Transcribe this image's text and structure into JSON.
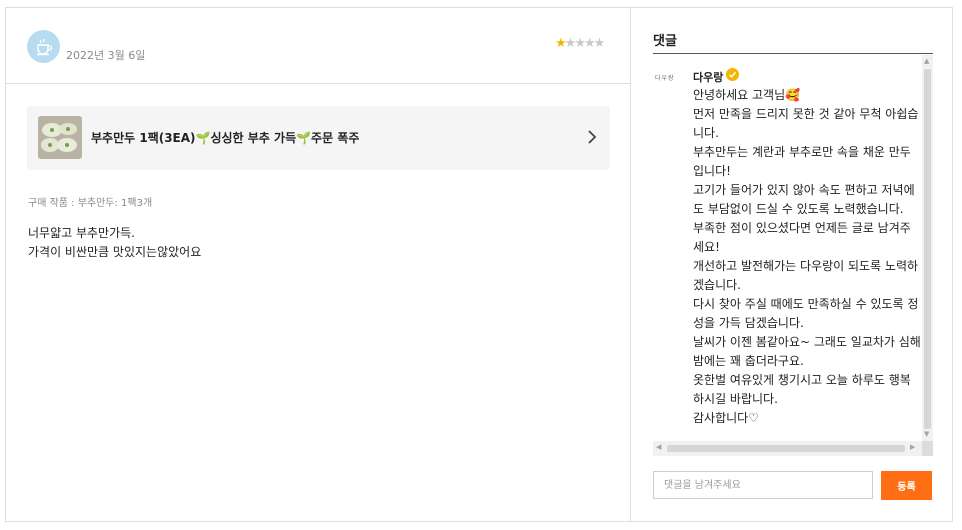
{
  "review": {
    "date": "2022년 3월 6일",
    "rating": 1,
    "rating_max": 5,
    "product_name": "부추만두 1팩(3EA)🌱싱싱한 부추 가득🌱주문 폭주",
    "purchase_info": "구매 작품 : 부추만두: 1팩3개",
    "text_lines": [
      "너무얇고 부추만가득.",
      "가격이 비싼만큼 맛있지는않았어요"
    ]
  },
  "comments": {
    "title": "댓글",
    "seller_logo": "다우랑",
    "seller_name": "다우랑",
    "text": "안녕하세요 고객님🥰\n먼저 만족을 드리지 못한 것 같아 무척 아쉽습니다.\n부추만두는 계란과 부추로만 속을 채운 만두입니다!\n고기가 들어가 있지 않아 속도 편하고 저녁에도 부담없이 드실 수 있도록 노력했습니다.\n부족한 점이 있으셨다면 언제든 글로 남겨주세요!\n개선하고 발전해가는 다우랑이 되도록 노력하겠습니다.\n다시 찾아 주실 때에도 만족하실 수 있도록 정성을 가득 담겠습니다.\n날씨가 이젠 봄같아요~ 그래도 일교차가 심해 밤에는 꽤 춥더라구요.\n옷한벌 여유있게 챙기시고 오늘 하루도 행복하시길 바랍니다.\n감사합니다♡",
    "input_placeholder": "댓글을 남겨주세요",
    "input_value": "",
    "submit_label": "등록"
  },
  "colors": {
    "accent": "#ff6d14",
    "star": "#f5b400",
    "avatar": "#b8dcef"
  },
  "icons": {
    "avatar": "coffee-cup-icon",
    "chevron": "chevron-right-icon",
    "badge": "verified-badge-icon"
  }
}
